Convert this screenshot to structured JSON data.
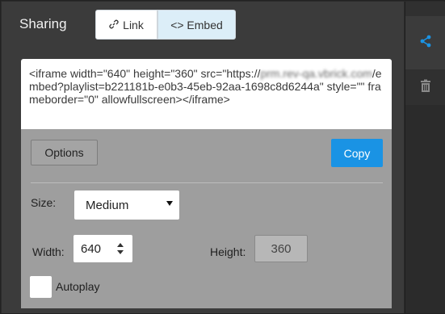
{
  "header": {
    "title": "Sharing",
    "tabs": [
      {
        "label": "Link",
        "icon": "link-icon",
        "active": false
      },
      {
        "label": "<> Embed",
        "icon": "code-icon",
        "active": true
      }
    ]
  },
  "embed": {
    "code_parts": [
      "<iframe width=\"640\" height=\"360\" src=\"https://",
      "prm.rev-qa.vbrick.com",
      "/embed?playlist=b221181b-e0b3-45eb-92aa-1698c8d6244a\" style=\"\" frameborder=\"0\" allowfullscreen></iframe>"
    ]
  },
  "actions": {
    "options_label": "Options",
    "copy_label": "Copy"
  },
  "options": {
    "size_label": "Size:",
    "size_value": "Medium",
    "width_label": "Width:",
    "width_value": "640",
    "height_label": "Height:",
    "height_value": "360",
    "autoplay_label": "Autoplay",
    "autoplay_checked": false
  },
  "side_toolbar": {
    "items": [
      {
        "icon": "share-icon",
        "active": true
      },
      {
        "icon": "trash-icon",
        "active": false
      }
    ]
  },
  "colors": {
    "accent": "#1a93e4",
    "panel_dark": "#3b3b3b",
    "options_bg": "#9e9e9e"
  }
}
